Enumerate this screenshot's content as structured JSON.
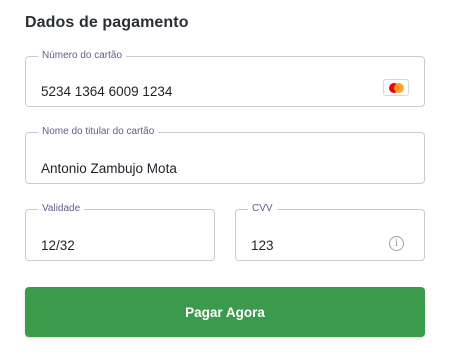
{
  "section": {
    "title": "Dados de pagamento"
  },
  "card_number": {
    "label": "Número do cartão",
    "value": "5234 1364 6009 1234",
    "brand_icon": "mastercard-icon"
  },
  "card_holder": {
    "label": "Nome do titular do cartão",
    "value": "Antonio Zambujo Mota"
  },
  "expiry": {
    "label": "Validade",
    "value": "12/32"
  },
  "cvv": {
    "label": "CVV",
    "value": "123",
    "info_icon_glyph": "i"
  },
  "pay_button": {
    "label": "Pagar Agora",
    "color": "#3c9a4c"
  },
  "colors": {
    "label_text": "#6a5a8c",
    "border": "#c8ccd3"
  }
}
